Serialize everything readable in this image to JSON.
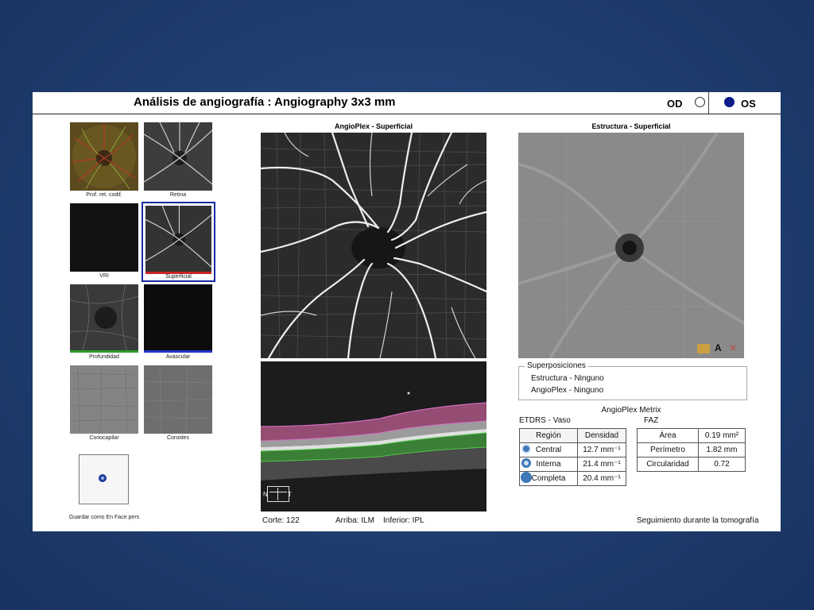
{
  "header": {
    "title": "Análisis de angiografía : Angiography 3x3 mm",
    "eye_od": "OD",
    "eye_os": "OS",
    "selected_eye": "OS"
  },
  "thumbnails": [
    {
      "label": "Prof. ret. codif.",
      "color_bar": ""
    },
    {
      "label": "Retina",
      "color_bar": ""
    },
    {
      "label": "VRI",
      "color_bar": ""
    },
    {
      "label": "Superficial",
      "color_bar": "#cc2222",
      "selected": true
    },
    {
      "label": "Profundidad",
      "color_bar": "#2e9a2e"
    },
    {
      "label": "Avascular",
      "color_bar": "#2233cc"
    },
    {
      "label": "Coriocapilar",
      "color_bar": ""
    },
    {
      "label": "Coroides",
      "color_bar": ""
    }
  ],
  "save_button_label": "Guardar como En Face pers",
  "angio_image_title": "AngioPlex - Superficial",
  "structure_image_title": "Estructura - Superficial",
  "bscan": {
    "corte_label": "Corte: 122",
    "arriba_label": "Arriba: ILM",
    "inferior_label": "Inferior: IPL",
    "orientation_left": "N",
    "orientation_right": "T"
  },
  "overlays": {
    "legend": "Superposiciones",
    "estructura": "Estructura - Ninguno",
    "angioplex": "AngioPlex - Ninguno"
  },
  "metrix": {
    "title": "AngioPlex Metrix",
    "vessel_title": "ETDRS - Vaso",
    "faz_title": "FAZ",
    "vessel_headers": [
      "Región",
      "Densidad"
    ],
    "vessel_rows": [
      {
        "region": "Central",
        "density": "12.7 mm⁻¹"
      },
      {
        "region": "Interna",
        "density": "21.4 mm⁻¹"
      },
      {
        "region": "Completa",
        "density": "20.4 mm⁻¹"
      }
    ],
    "faz_rows": [
      {
        "name": "Área",
        "value": "0.19 mm²"
      },
      {
        "name": "Perímetro",
        "value": "1.82 mm"
      },
      {
        "name": "Circularidad",
        "value": "0.72"
      }
    ]
  },
  "footer": {
    "tracking": "Seguimiento durante la tomografía"
  },
  "colors": {
    "background": "#1f3d6e",
    "selected_eye": "#0d1a8a",
    "selected_thumb_border": "#1a2aa0",
    "region_icon": "#3f78b8"
  }
}
